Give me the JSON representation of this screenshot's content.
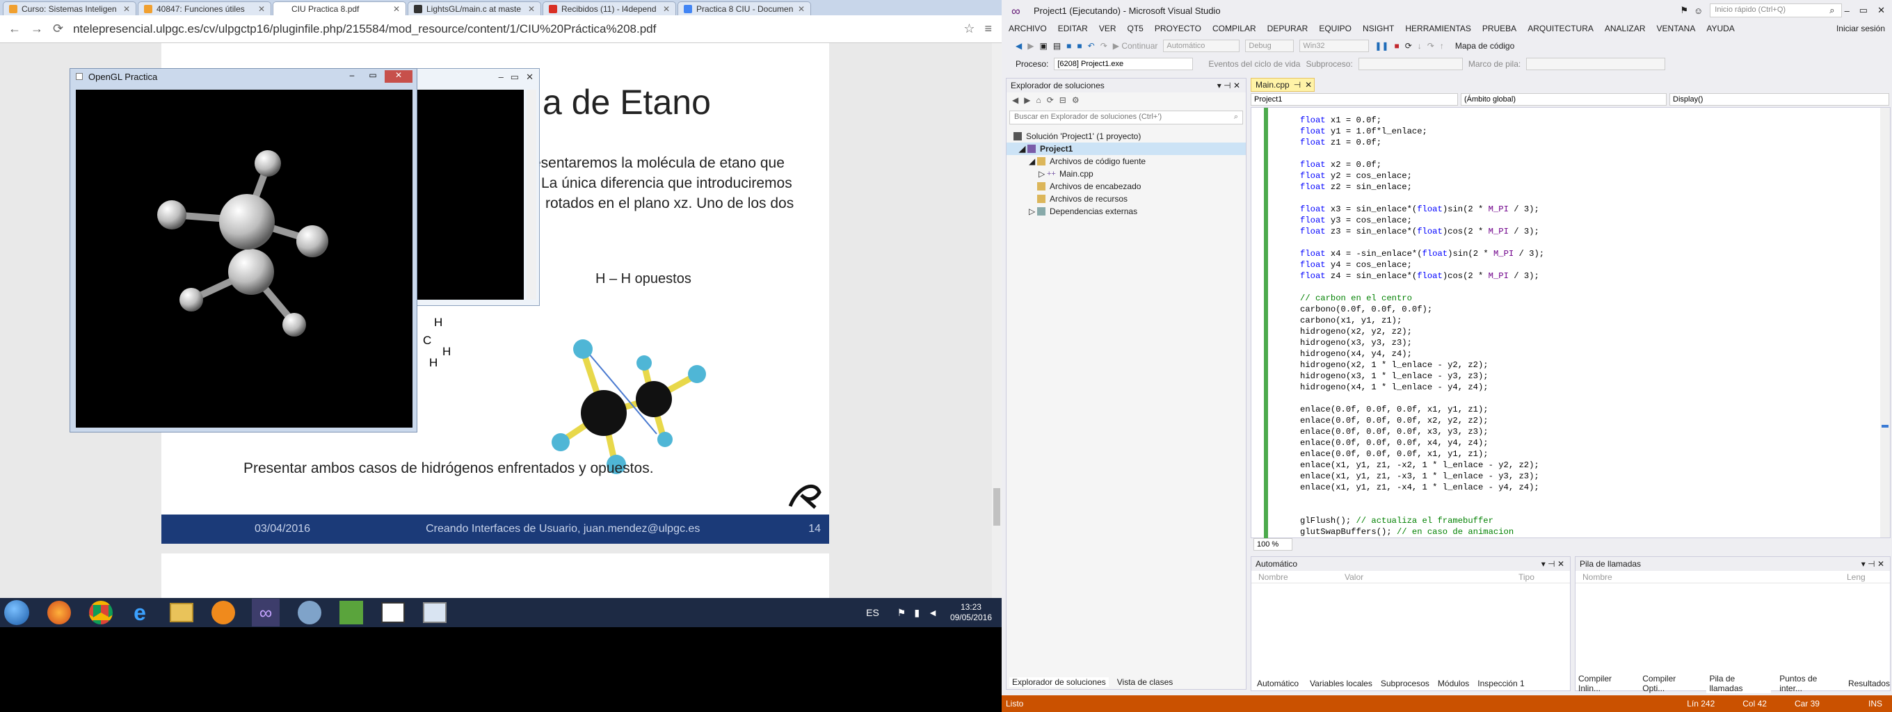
{
  "browser": {
    "tabs": [
      {
        "label": "Curso: Sistemas Inteligen",
        "color": "#f0a030"
      },
      {
        "label": "40847: Funciones útiles",
        "color": "#f0a030"
      },
      {
        "label": "CIU Practica 8.pdf",
        "color": "#ffffff"
      },
      {
        "label": "LightsGL/main.c at maste",
        "color": "#333333"
      },
      {
        "label": "Recibidos (11) - l4depend",
        "color": "#d93025"
      },
      {
        "label": "Practica 8 CIU - Documen",
        "color": "#4285f4"
      }
    ],
    "url": "ntelepresencial.ulpgc.es/cv/ulpgctp16/pluginfile.php/215584/mod_resource/content/1/CIU%20Práctica%208.pdf"
  },
  "slide": {
    "title": "a de Etano",
    "text_lines": [
      "esentaremos la molécula de etano que",
      "La única diferencia que introduciremos",
      "rotados en el plano xz. Uno de los dos"
    ],
    "caption": "H – H opuestos",
    "formula_h1": "H",
    "formula_c": "C",
    "formula_h2": "H",
    "formula_h3": "H",
    "instruction": "Presentar ambos casos de hidrógenos enfrentados y opuestos.",
    "footer_date": "03/04/2016",
    "footer_title": "Creando Interfaces de Usuario, juan.mendez@ulpgc.es",
    "footer_page": "14"
  },
  "gl_window": {
    "title": "OpenGL Practica"
  },
  "taskbar": {
    "lang": "ES",
    "time": "13:23",
    "date": "09/05/2016"
  },
  "vs": {
    "title": "Project1 (Ejecutando) - Microsoft Visual Studio",
    "quick_launch": "Inicio rápido (Ctrl+Q)",
    "signin": "Iniciar sesión",
    "menu": [
      "ARCHIVO",
      "EDITAR",
      "VER",
      "QT5",
      "PROYECTO",
      "COMPILAR",
      "DEPURAR",
      "EQUIPO",
      "NSIGHT",
      "HERRAMIENTAS",
      "PRUEBA",
      "ARQUITECTURA",
      "ANALIZAR",
      "VENTANA",
      "AYUDA"
    ],
    "toolbar": {
      "continue": "Continuar",
      "auto": "Automático",
      "config": "Debug",
      "platform": "Win32",
      "codemap": "Mapa de código"
    },
    "process_label": "Proceso:",
    "process_value": "[6208] Project1.exe",
    "lifecycle": "Eventos del ciclo de vida",
    "thread": "Subproceso:",
    "stackframe": "Marco de pila:",
    "solution_explorer": {
      "title": "Explorador de soluciones",
      "search": "Buscar en Explorador de soluciones (Ctrl+')",
      "items": [
        {
          "label": "Solución 'Project1'  (1 proyecto)",
          "indent": 0
        },
        {
          "label": "Project1",
          "indent": 1
        },
        {
          "label": "Archivos de código fuente",
          "indent": 2
        },
        {
          "label": "Main.cpp",
          "indent": 3
        },
        {
          "label": "Archivos de encabezado",
          "indent": 2
        },
        {
          "label": "Archivos de recursos",
          "indent": 2
        },
        {
          "label": "Dependencias externas",
          "indent": 2
        }
      ],
      "bottom_tabs": [
        "Explorador de soluciones",
        "Vista de clases"
      ]
    },
    "editor": {
      "tab": "Main.cpp",
      "combo_project": "Project1",
      "combo_scope": "(Ámbito global)",
      "combo_func": "Display()",
      "zoom": "100 %",
      "code": [
        "float x1 = 0.0f;",
        "float y1 = 1.0f*l_enlace;",
        "float z1 = 0.0f;",
        "",
        "float x2 = 0.0f;",
        "float y2 = cos_enlace;",
        "float z2 = sin_enlace;",
        "",
        "float x3 = sin_enlace*(float)sin(2 * M_PI / 3);",
        "float y3 = cos_enlace;",
        "float z3 = sin_enlace*(float)cos(2 * M_PI / 3);",
        "",
        "float x4 = -sin_enlace*(float)sin(2 * M_PI / 3);",
        "float y4 = cos_enlace;",
        "float z4 = sin_enlace*(float)cos(2 * M_PI / 3);",
        "",
        "// carbon en el centro",
        "carbono(0.0f, 0.0f, 0.0f);",
        "carbono(x1, y1, z1);",
        "hidrogeno(x2, y2, z2);",
        "hidrogeno(x3, y3, z3);",
        "hidrogeno(x4, y4, z4);",
        "hidrogeno(x2, 1 * l_enlace - y2, z2);",
        "hidrogeno(x3, 1 * l_enlace - y3, z3);",
        "hidrogeno(x4, 1 * l_enlace - y4, z4);",
        "",
        "enlace(0.0f, 0.0f, 0.0f, x1, y1, z1);",
        "enlace(0.0f, 0.0f, 0.0f, x2, y2, z2);",
        "enlace(0.0f, 0.0f, 0.0f, x3, y3, z3);",
        "enlace(0.0f, 0.0f, 0.0f, x4, y4, z4);",
        "enlace(0.0f, 0.0f, 0.0f, x1, y1, z1);",
        "enlace(x1, y1, z1, -x2, 1 * l_enlace - y2, z2);",
        "enlace(x1, y1, z1, -x3, 1 * l_enlace - y3, z3);",
        "enlace(x1, y1, z1, -x4, 1 * l_enlace - y4, z4);",
        "",
        "",
        "glFlush(); // actualiza el framebuffer",
        "glutSwapBuffers(); // en caso de animacion"
      ]
    },
    "auto_pane": {
      "title": "Automático",
      "cols": [
        "Nombre",
        "Valor",
        "Tipo"
      ],
      "tabs": [
        "Automático",
        "Variables locales",
        "Subprocesos",
        "Módulos",
        "Inspección 1"
      ]
    },
    "stack_pane": {
      "title": "Pila de llamadas",
      "cols": [
        "Nombre",
        "Leng"
      ],
      "tabs": [
        "Compiler Inlin...",
        "Compiler Opti...",
        "Pila de llamadas",
        "Puntos de inter...",
        "Resultados"
      ]
    },
    "status": {
      "ready": "Listo",
      "line": "Lín 242",
      "col": "Col 42",
      "char": "Car 39",
      "ins": "INS"
    }
  }
}
